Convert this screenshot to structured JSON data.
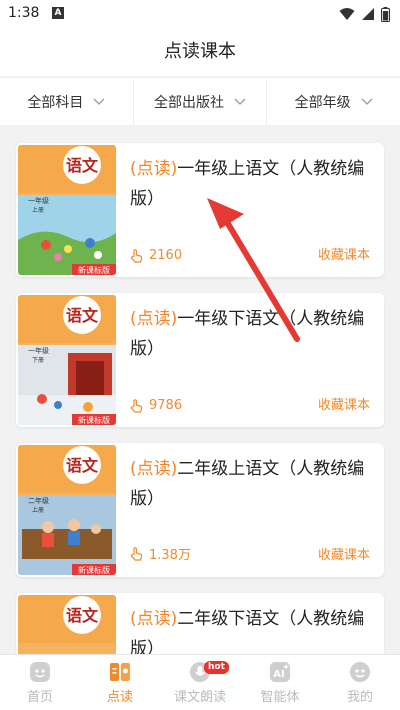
{
  "status": {
    "time": "1:38"
  },
  "header": {
    "title": "点读课本"
  },
  "filters": [
    {
      "label": "全部科目"
    },
    {
      "label": "全部出版社"
    },
    {
      "label": "全部年级"
    }
  ],
  "books": [
    {
      "tag": "(点读)",
      "title": "一年级上语文（人教统编版）",
      "count": "2160",
      "fav": "收藏课本",
      "cover_subject": "语文",
      "cover_grade": "一年级",
      "cover_term": "上册",
      "cover_badge": "新课标版"
    },
    {
      "tag": "(点读)",
      "title": "一年级下语文（人教统编版）",
      "count": "9786",
      "fav": "收藏课本",
      "cover_subject": "语文",
      "cover_grade": "一年级",
      "cover_term": "下册",
      "cover_badge": "新课标版"
    },
    {
      "tag": "(点读)",
      "title": "二年级上语文（人教统编版）",
      "count": "1.38万",
      "fav": "收藏课本",
      "cover_subject": "语文",
      "cover_grade": "二年级",
      "cover_term": "上册",
      "cover_badge": "新课标版"
    },
    {
      "tag": "(点读)",
      "title": "二年级下语文（人教统编版）",
      "count": "",
      "fav": "",
      "cover_subject": "语文",
      "cover_grade": "",
      "cover_term": "",
      "cover_badge": ""
    }
  ],
  "tabs": [
    {
      "label": "首页",
      "icon": "home-face-icon"
    },
    {
      "label": "点读",
      "icon": "read-book-icon"
    },
    {
      "label": "课文朗读",
      "icon": "microphone-icon",
      "badge": "hot"
    },
    {
      "label": "智能体",
      "icon": "ai-icon"
    },
    {
      "label": "我的",
      "icon": "profile-face-icon"
    }
  ],
  "colors": {
    "accent": "#f08a2a",
    "badge": "#e8322a",
    "arrow": "#e53935"
  }
}
